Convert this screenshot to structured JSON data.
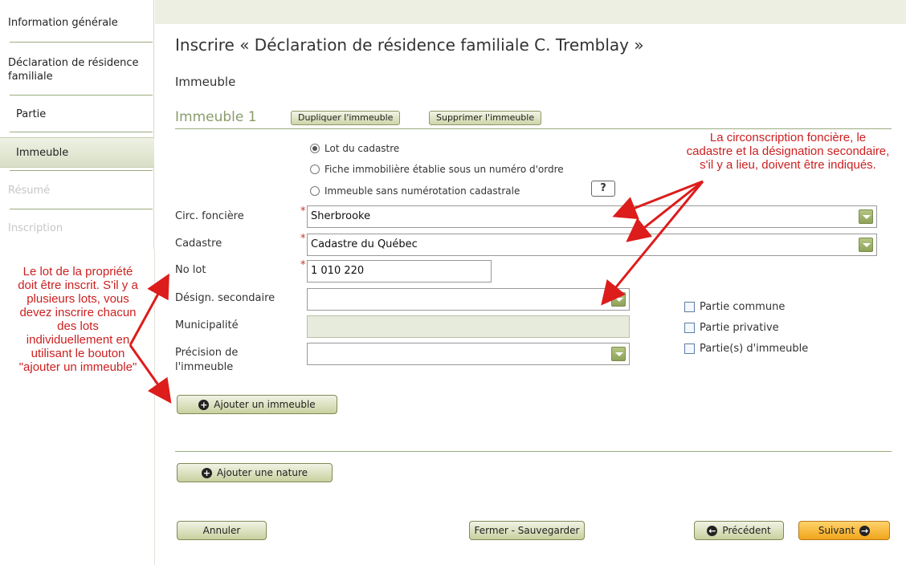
{
  "sidebar": {
    "items": [
      {
        "label": "Information générale"
      },
      {
        "label": "Déclaration de résidence familiale"
      },
      {
        "label": "Partie"
      },
      {
        "label": "Immeuble"
      },
      {
        "label": "Résumé"
      },
      {
        "label": "Inscription"
      }
    ]
  },
  "page": {
    "title": "Inscrire « Déclaration de résidence familiale C. Tremblay »",
    "section": "Immeuble",
    "immeuble_title": "Immeuble 1",
    "duplicate_label": "Dupliquer l'immeuble",
    "delete_label": "Supprimer l'immeuble"
  },
  "radios": [
    {
      "label": "Lot du cadastre",
      "checked": true
    },
    {
      "label": "Fiche immobilière établie sous un numéro d'ordre",
      "checked": false
    },
    {
      "label": "Immeuble sans numérotation cadastrale",
      "checked": false
    }
  ],
  "help_label": "?",
  "fields": {
    "circ": {
      "label": "Circ. foncière",
      "value": "Sherbrooke"
    },
    "cadastre": {
      "label": "Cadastre",
      "value": "Cadastre du Québec"
    },
    "lot": {
      "label": "No lot",
      "value": "1 010 220"
    },
    "design": {
      "label": "Désign. secondaire",
      "value": ""
    },
    "municipalite": {
      "label": "Municipalité",
      "value": ""
    },
    "precision": {
      "label_line1": "Précision de",
      "label_line2": "l'immeuble",
      "value": ""
    }
  },
  "checkboxes": [
    {
      "label": "Partie commune"
    },
    {
      "label": "Partie privative"
    },
    {
      "label": "Partie(s) d'immeuble"
    }
  ],
  "buttons": {
    "add_immeuble": "Ajouter un immeuble",
    "add_nature": "Ajouter une nature",
    "cancel": "Annuler",
    "close_save": "Fermer - Sauvegarder",
    "previous": "Précédent",
    "next": "Suivant"
  },
  "notes": {
    "right": "La circonscription foncière, le cadastre et la désignation secondaire, s'il y a lieu, doivent être indiqués.",
    "left": "Le lot de la propriété doit être inscrit. S'il y a plusieurs lots, vous devez inscrire chacun des lots individuellement en utilisant le bouton \"ajouter un immeuble\""
  },
  "colors": {
    "accent": "#9bab80",
    "note_red": "#cc2020",
    "next_orange": "#f1a41b"
  }
}
